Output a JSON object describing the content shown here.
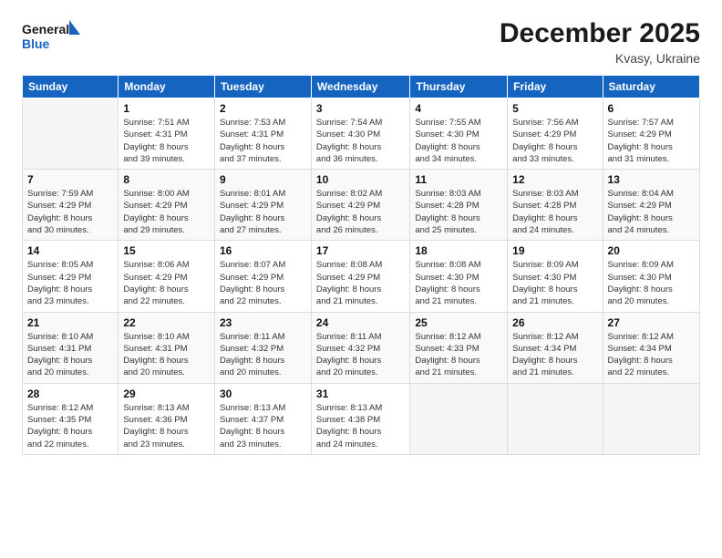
{
  "header": {
    "logo_line1": "General",
    "logo_line2": "Blue",
    "title": "December 2025",
    "subtitle": "Kvasy, Ukraine"
  },
  "days_of_week": [
    "Sunday",
    "Monday",
    "Tuesday",
    "Wednesday",
    "Thursday",
    "Friday",
    "Saturday"
  ],
  "weeks": [
    [
      {
        "num": "",
        "info": ""
      },
      {
        "num": "1",
        "info": "Sunrise: 7:51 AM\nSunset: 4:31 PM\nDaylight: 8 hours\nand 39 minutes."
      },
      {
        "num": "2",
        "info": "Sunrise: 7:53 AM\nSunset: 4:31 PM\nDaylight: 8 hours\nand 37 minutes."
      },
      {
        "num": "3",
        "info": "Sunrise: 7:54 AM\nSunset: 4:30 PM\nDaylight: 8 hours\nand 36 minutes."
      },
      {
        "num": "4",
        "info": "Sunrise: 7:55 AM\nSunset: 4:30 PM\nDaylight: 8 hours\nand 34 minutes."
      },
      {
        "num": "5",
        "info": "Sunrise: 7:56 AM\nSunset: 4:29 PM\nDaylight: 8 hours\nand 33 minutes."
      },
      {
        "num": "6",
        "info": "Sunrise: 7:57 AM\nSunset: 4:29 PM\nDaylight: 8 hours\nand 31 minutes."
      }
    ],
    [
      {
        "num": "7",
        "info": "Sunrise: 7:59 AM\nSunset: 4:29 PM\nDaylight: 8 hours\nand 30 minutes."
      },
      {
        "num": "8",
        "info": "Sunrise: 8:00 AM\nSunset: 4:29 PM\nDaylight: 8 hours\nand 29 minutes."
      },
      {
        "num": "9",
        "info": "Sunrise: 8:01 AM\nSunset: 4:29 PM\nDaylight: 8 hours\nand 27 minutes."
      },
      {
        "num": "10",
        "info": "Sunrise: 8:02 AM\nSunset: 4:29 PM\nDaylight: 8 hours\nand 26 minutes."
      },
      {
        "num": "11",
        "info": "Sunrise: 8:03 AM\nSunset: 4:28 PM\nDaylight: 8 hours\nand 25 minutes."
      },
      {
        "num": "12",
        "info": "Sunrise: 8:03 AM\nSunset: 4:28 PM\nDaylight: 8 hours\nand 24 minutes."
      },
      {
        "num": "13",
        "info": "Sunrise: 8:04 AM\nSunset: 4:29 PM\nDaylight: 8 hours\nand 24 minutes."
      }
    ],
    [
      {
        "num": "14",
        "info": "Sunrise: 8:05 AM\nSunset: 4:29 PM\nDaylight: 8 hours\nand 23 minutes."
      },
      {
        "num": "15",
        "info": "Sunrise: 8:06 AM\nSunset: 4:29 PM\nDaylight: 8 hours\nand 22 minutes."
      },
      {
        "num": "16",
        "info": "Sunrise: 8:07 AM\nSunset: 4:29 PM\nDaylight: 8 hours\nand 22 minutes."
      },
      {
        "num": "17",
        "info": "Sunrise: 8:08 AM\nSunset: 4:29 PM\nDaylight: 8 hours\nand 21 minutes."
      },
      {
        "num": "18",
        "info": "Sunrise: 8:08 AM\nSunset: 4:30 PM\nDaylight: 8 hours\nand 21 minutes."
      },
      {
        "num": "19",
        "info": "Sunrise: 8:09 AM\nSunset: 4:30 PM\nDaylight: 8 hours\nand 21 minutes."
      },
      {
        "num": "20",
        "info": "Sunrise: 8:09 AM\nSunset: 4:30 PM\nDaylight: 8 hours\nand 20 minutes."
      }
    ],
    [
      {
        "num": "21",
        "info": "Sunrise: 8:10 AM\nSunset: 4:31 PM\nDaylight: 8 hours\nand 20 minutes."
      },
      {
        "num": "22",
        "info": "Sunrise: 8:10 AM\nSunset: 4:31 PM\nDaylight: 8 hours\nand 20 minutes."
      },
      {
        "num": "23",
        "info": "Sunrise: 8:11 AM\nSunset: 4:32 PM\nDaylight: 8 hours\nand 20 minutes."
      },
      {
        "num": "24",
        "info": "Sunrise: 8:11 AM\nSunset: 4:32 PM\nDaylight: 8 hours\nand 20 minutes."
      },
      {
        "num": "25",
        "info": "Sunrise: 8:12 AM\nSunset: 4:33 PM\nDaylight: 8 hours\nand 21 minutes."
      },
      {
        "num": "26",
        "info": "Sunrise: 8:12 AM\nSunset: 4:34 PM\nDaylight: 8 hours\nand 21 minutes."
      },
      {
        "num": "27",
        "info": "Sunrise: 8:12 AM\nSunset: 4:34 PM\nDaylight: 8 hours\nand 22 minutes."
      }
    ],
    [
      {
        "num": "28",
        "info": "Sunrise: 8:12 AM\nSunset: 4:35 PM\nDaylight: 8 hours\nand 22 minutes."
      },
      {
        "num": "29",
        "info": "Sunrise: 8:13 AM\nSunset: 4:36 PM\nDaylight: 8 hours\nand 23 minutes."
      },
      {
        "num": "30",
        "info": "Sunrise: 8:13 AM\nSunset: 4:37 PM\nDaylight: 8 hours\nand 23 minutes."
      },
      {
        "num": "31",
        "info": "Sunrise: 8:13 AM\nSunset: 4:38 PM\nDaylight: 8 hours\nand 24 minutes."
      },
      {
        "num": "",
        "info": ""
      },
      {
        "num": "",
        "info": ""
      },
      {
        "num": "",
        "info": ""
      }
    ]
  ]
}
